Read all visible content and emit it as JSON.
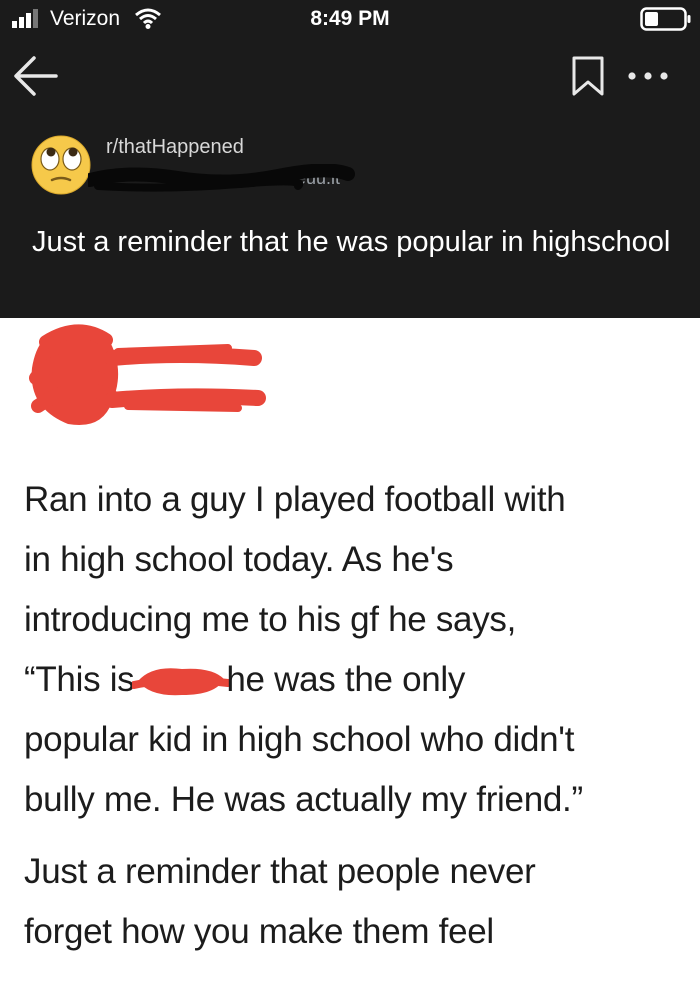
{
  "status_bar": {
    "carrier": "Verizon",
    "time": "8:49 PM"
  },
  "nav": {
    "back_icon": "back-arrow-icon",
    "bookmark_icon": "bookmark-icon",
    "more_icon": "more-dots-icon"
  },
  "post": {
    "subreddit": "r/thatHappened",
    "username_visible_fragment": "euu.it",
    "title": "Just a reminder that he was popular in highschool",
    "avatar_icon": "rolling-eyes-emoji"
  },
  "screenshot": {
    "lines": [
      "Ran into a guy I played football with",
      "in high school today. As he's",
      "introducing me to his gf he says,"
    ],
    "line4_before": "“This is",
    "line4_after": "he was the only",
    "lines_after": [
      "popular kid in high school who didn't",
      "bully me. He was actually my friend.”"
    ],
    "closing_lines": [
      "Just a reminder that people never",
      "forget how you make them feel"
    ]
  },
  "colors": {
    "background_dark": "#1b1b1b",
    "image_background": "#ffffff",
    "redaction_red": "#e8463a"
  }
}
